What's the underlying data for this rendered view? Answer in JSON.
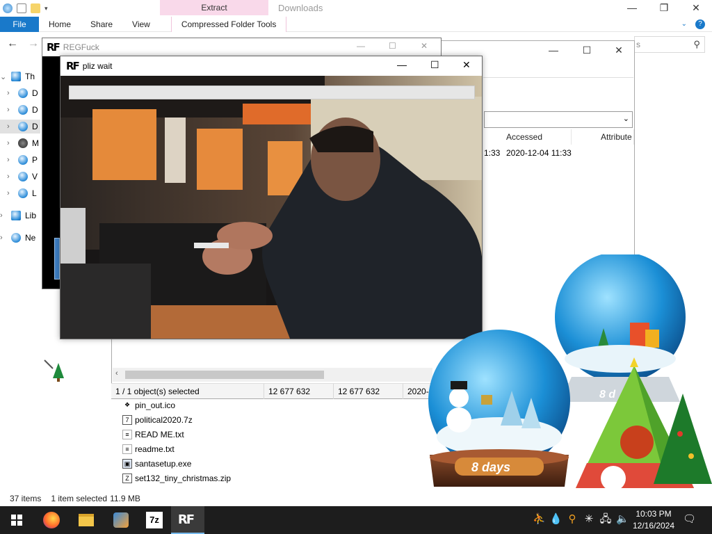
{
  "explorer": {
    "title": "Downloads",
    "ribbon": {
      "context_group": "Extract",
      "tabs": [
        "File",
        "Home",
        "Share",
        "View",
        "Compressed Folder Tools"
      ]
    },
    "search_placeholder": "s",
    "nav": {
      "items": [
        {
          "label": "Th",
          "icon": "this-pc-icon"
        },
        {
          "label": "D",
          "icon": "drive-icon"
        },
        {
          "label": "D",
          "icon": "drive-icon"
        },
        {
          "label": "D",
          "icon": "drive-icon"
        },
        {
          "label": "M",
          "icon": "music-icon"
        },
        {
          "label": "P",
          "icon": "pictures-icon"
        },
        {
          "label": "V",
          "icon": "videos-icon"
        },
        {
          "label": "L",
          "icon": "drive-icon"
        },
        {
          "label": "Lib",
          "icon": "libraries-icon"
        },
        {
          "label": "Ne",
          "icon": "network-icon"
        }
      ]
    },
    "files": [
      {
        "name": "pin_out.ico",
        "icon": "ico-file-icon"
      },
      {
        "name": "political2020.7z",
        "icon": "7z-file-icon"
      },
      {
        "name": "READ ME.txt",
        "icon": "text-file-icon"
      },
      {
        "name": "readme.txt",
        "icon": "text-file-icon"
      },
      {
        "name": "santasetup.exe",
        "icon": "exe-file-icon"
      },
      {
        "name": "set132_tiny_christmas.zip",
        "icon": "zip-file-icon"
      }
    ],
    "status": {
      "items_count": "37 items",
      "selected": "1 item selected",
      "size": "11.9 MB"
    }
  },
  "regfuck_window": {
    "logo": "RF",
    "title": "REGFuck"
  },
  "properties_window": {
    "columns": [
      "Accessed",
      "Attribute"
    ],
    "row": {
      "time_fragment": "1:33",
      "accessed": "2020-12-04 11:33"
    },
    "status": [
      "1 / 1 object(s) selected",
      "12 677 632",
      "12 677 632",
      "2020-0"
    ]
  },
  "pliz_window": {
    "logo": "RF",
    "title": "pliz wait",
    "progress": 0.0
  },
  "desktop": {
    "globe_left_text": "8 days",
    "globe_right_text": "8 d"
  },
  "taskbar": {
    "apps": [
      "start-icon",
      "firefox-icon",
      "file-explorer-icon",
      "paint-icon",
      "7zip-icon",
      "regfuck-icon"
    ],
    "label_7z": "7z",
    "label_rf": "RF",
    "time": "10:03 PM",
    "date": "12/16/2024"
  },
  "colors": {
    "file_tab": "#1979ca",
    "context_tab": "#f9d9ea",
    "taskbar": "#1d1d1d"
  }
}
